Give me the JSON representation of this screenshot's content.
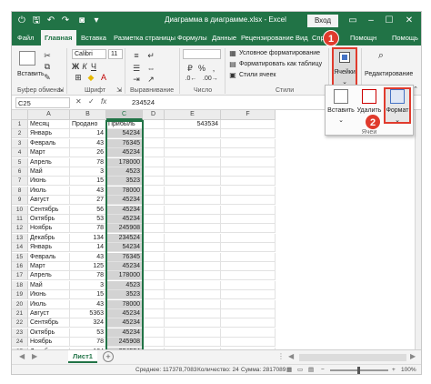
{
  "app": {
    "title": "Диаграмма в диаграмме.xlsx - Excel",
    "signin": "Вход"
  },
  "quick_access": {
    "autosave_icon": "autosave-icon",
    "save_icon": "save-icon",
    "undo_icon": "undo-icon",
    "redo_icon": "redo-icon",
    "camera_icon": "camera-icon"
  },
  "tabs": [
    "Файл",
    "Главная",
    "Вставка",
    "Разметка страницы",
    "Формулы",
    "Данные",
    "Рецензирование",
    "Вид",
    "Спра",
    "Помощн",
    "Помощь"
  ],
  "ribbon": {
    "clipboard": {
      "paste": "Вставить",
      "label": "Буфер обмена"
    },
    "font": {
      "name": "Calibri",
      "size": "11",
      "label": "Шрифт",
      "bold": "Ж",
      "italic": "К",
      "underline": "Ч"
    },
    "alignment": {
      "label": "Выравнивание"
    },
    "number": {
      "label": "Число",
      "percent": "%"
    },
    "styles": {
      "conditional": "Условное форматирование",
      "as_table": "Форматировать как таблицу",
      "cell_styles": "Стили ячеек",
      "label": "Стили"
    },
    "cells": {
      "label": "Ячейки"
    },
    "editing": {
      "label": "Редактирование"
    },
    "cells_panel": {
      "insert": "Вставить",
      "delete": "Удалить",
      "format": "Формат",
      "footer": "Ячей"
    }
  },
  "badges": {
    "one": "1",
    "two": "2"
  },
  "formula_bar": {
    "name_box": "C25",
    "fx": "fx",
    "value": "234524"
  },
  "columns": [
    "A",
    "B",
    "C",
    "D",
    "E",
    "F"
  ],
  "header_row": {
    "a": "Месяц",
    "b": "Продано",
    "c": "Прибыль"
  },
  "extra_cell": {
    "ref": "E1",
    "value": "543534"
  },
  "rows": [
    {
      "month": "Январь",
      "sold": "14",
      "profit": "54234"
    },
    {
      "month": "Февраль",
      "sold": "43",
      "profit": "76345"
    },
    {
      "month": "Март",
      "sold": "26",
      "profit": "45234"
    },
    {
      "month": "Апрель",
      "sold": "78",
      "profit": "178000"
    },
    {
      "month": "Май",
      "sold": "3",
      "profit": "4523"
    },
    {
      "month": "Июнь",
      "sold": "15",
      "profit": "3523"
    },
    {
      "month": "Июль",
      "sold": "43",
      "profit": "78000"
    },
    {
      "month": "Август",
      "sold": "27",
      "profit": "45234"
    },
    {
      "month": "Сентябрь",
      "sold": "56",
      "profit": "45234"
    },
    {
      "month": "Октябрь",
      "sold": "53",
      "profit": "45234"
    },
    {
      "month": "Ноябрь",
      "sold": "78",
      "profit": "245908"
    },
    {
      "month": "Декабрь",
      "sold": "134",
      "profit": "234524"
    },
    {
      "month": "Январь",
      "sold": "14",
      "profit": "54234"
    },
    {
      "month": "Февраль",
      "sold": "43",
      "profit": "76345"
    },
    {
      "month": "Март",
      "sold": "125",
      "profit": "45234"
    },
    {
      "month": "Апрель",
      "sold": "78",
      "profit": "178000"
    },
    {
      "month": "Май",
      "sold": "3",
      "profit": "4523"
    },
    {
      "month": "Июнь",
      "sold": "15",
      "profit": "3523"
    },
    {
      "month": "Июль",
      "sold": "43",
      "profit": "78000"
    },
    {
      "month": "Август",
      "sold": "5363",
      "profit": "45234"
    },
    {
      "month": "Сентябрь",
      "sold": "324",
      "profit": "45234"
    },
    {
      "month": "Октябрь",
      "sold": "53",
      "profit": "45234"
    },
    {
      "month": "Ноябрь",
      "sold": "78",
      "profit": "245908"
    },
    {
      "month": "Декабрь",
      "sold": "134",
      "profit": "234524"
    }
  ],
  "sheet": {
    "name": "Лист1",
    "add": "+"
  },
  "status": {
    "average": "Среднее: 117378,7083",
    "count": "Количество: 24",
    "sum": "Сумма: 2817089",
    "zoom": "100%"
  }
}
